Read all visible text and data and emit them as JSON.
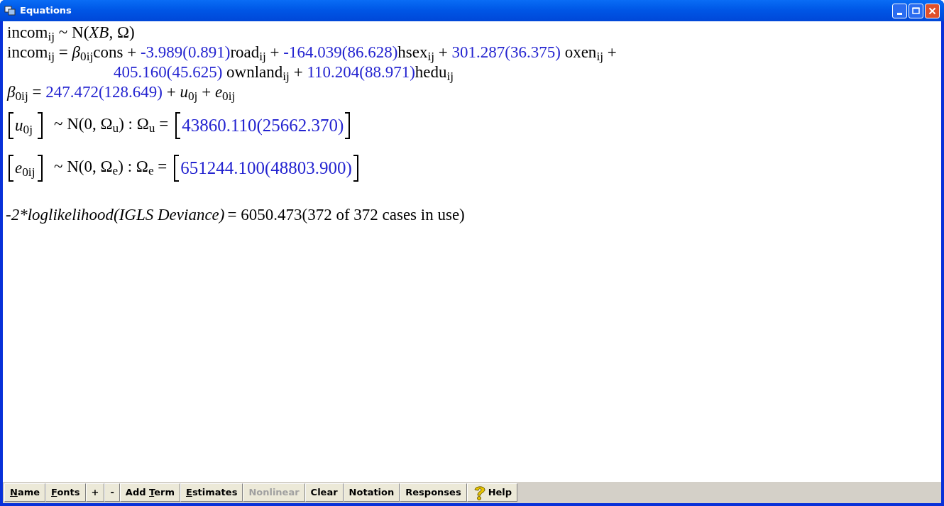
{
  "window": {
    "title": "Equations"
  },
  "equations": [
    {
      "kind": "line",
      "segments": [
        {
          "kind": "term",
          "text": "incom$_{ij}$ ~ N(*XB,* Ω)"
        }
      ]
    },
    {
      "kind": "line",
      "segments": [
        {
          "kind": "term",
          "text": "incom$_{ij}$ = *β*$_{0ij}$cons + "
        },
        {
          "kind": "estimate",
          "text": "-3.989(0.891)"
        },
        {
          "kind": "term",
          "text": "road$_{ij}$ + "
        },
        {
          "kind": "estimate",
          "text": "-164.039(86.628)"
        },
        {
          "kind": "term",
          "text": "hsex$_{ij}$ + "
        },
        {
          "kind": "estimate",
          "text": "301.287(36.375)"
        },
        {
          "kind": "term",
          "text": " oxen$_{ij}$ +"
        }
      ]
    },
    {
      "kind": "continuation",
      "segments": [
        {
          "kind": "estimate",
          "text": "405.160(45.625)"
        },
        {
          "kind": "term",
          "text": " ownland$_{ij}$ + "
        },
        {
          "kind": "estimate",
          "text": "110.204(88.971)"
        },
        {
          "kind": "term",
          "text": "hedu$_{ij}$"
        }
      ]
    },
    {
      "kind": "line",
      "segments": [
        {
          "kind": "term",
          "text": "*β*$_{0ij}$ = "
        },
        {
          "kind": "estimate",
          "text": "247.472(128.649)"
        },
        {
          "kind": "term",
          "text": " + *u*$_{0j}$ + *e*$_{0ij}$"
        }
      ]
    }
  ],
  "variances": [
    {
      "vector": "*u*$_{0j}$",
      "distribution": "~ N(0, Ω$_{u}$) : Ω$_{u}$ =",
      "value": "43860.110(25662.370)"
    },
    {
      "vector": "*e*$_{0ij}$",
      "distribution": "~ N(0, Ω$_{e}$) : Ω$_{e}$ =",
      "value": "651244.100(48803.900)"
    }
  ],
  "deviance": {
    "label": "-2*loglikelihood(IGLS Deviance)",
    "value": "= 6050.473(372 of 372 cases in use)"
  },
  "toolbar": [
    {
      "accel": "N",
      "after": "ame",
      "disabled": false
    },
    {
      "accel": "F",
      "after": "onts",
      "disabled": false
    },
    {
      "before": "+",
      "disabled": false
    },
    {
      "before": "-",
      "disabled": false
    },
    {
      "before": "Add ",
      "accel": "T",
      "after": "erm",
      "disabled": false
    },
    {
      "accel": "E",
      "after": "stimates",
      "disabled": false
    },
    {
      "before": "Nonlinear",
      "disabled": true
    },
    {
      "before": "Clear",
      "disabled": false
    },
    {
      "before": "Notation",
      "disabled": false
    },
    {
      "before": "Responses",
      "disabled": false
    },
    {
      "kind": "help",
      "before": "Help",
      "disabled": false
    }
  ]
}
